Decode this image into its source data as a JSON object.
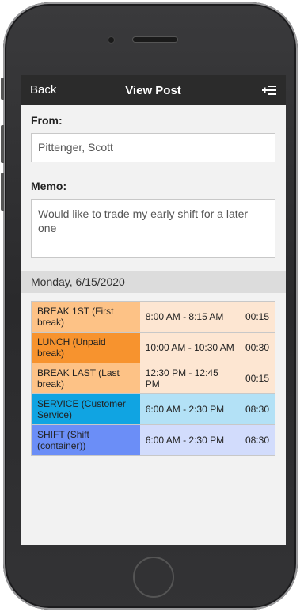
{
  "navbar": {
    "back_label": "Back",
    "title": "View Post",
    "action_icon": "add-list-icon"
  },
  "from": {
    "label": "From:",
    "value": "Pittenger, Scott"
  },
  "memo": {
    "label": "Memo:",
    "value": "Would like to trade my early shift for a later one"
  },
  "date_header": "Monday, 6/15/2020",
  "segments": [
    {
      "name": "BREAK 1ST (First break)",
      "time": "8:00 AM - 8:15 AM",
      "duration": "00:15",
      "name_color": "#fdc286",
      "row_color": "#fde6d2"
    },
    {
      "name": "LUNCH (Unpaid break)",
      "time": "10:00 AM - 10:30 AM",
      "duration": "00:30",
      "name_color": "#f7932e",
      "row_color": "#fde6d2"
    },
    {
      "name": "BREAK LAST (Last break)",
      "time": "12:30 PM - 12:45 PM",
      "duration": "00:15",
      "name_color": "#fdc286",
      "row_color": "#fde6d2"
    },
    {
      "name": "SERVICE (Customer Service)",
      "time": "6:00 AM - 2:30 PM",
      "duration": "08:30",
      "name_color": "#10a4e2",
      "row_color": "#b3e1f6"
    },
    {
      "name": "SHIFT (Shift (container))",
      "time": "6:00 AM - 2:30 PM",
      "duration": "08:30",
      "name_color": "#6b8ef7",
      "row_color": "#d2dcfc"
    }
  ]
}
